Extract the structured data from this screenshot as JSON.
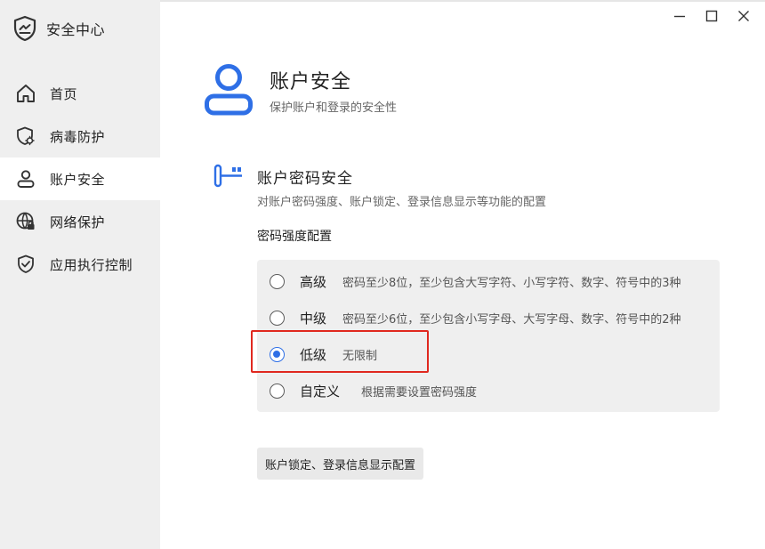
{
  "app": {
    "title": "安全中心",
    "icon": "shield-icon"
  },
  "sidebar": {
    "items": [
      {
        "label": "首页",
        "icon": "home-icon",
        "active": false
      },
      {
        "label": "病毒防护",
        "icon": "virus-shield-icon",
        "active": false
      },
      {
        "label": "账户安全",
        "icon": "user-icon",
        "active": true
      },
      {
        "label": "网络保护",
        "icon": "globe-lock-icon",
        "active": false
      },
      {
        "label": "应用执行控制",
        "icon": "app-shield-icon",
        "active": false
      }
    ]
  },
  "window_controls": {
    "minimize": "minimize-icon",
    "maximize": "maximize-icon",
    "close": "close-icon"
  },
  "header": {
    "title": "账户安全",
    "subtitle": "保护账户和登录的安全性"
  },
  "section": {
    "title": "账户密码安全",
    "description": "对账户密码强度、账户锁定、登录信息显示等功能的配置",
    "strength_label": "密码强度配置"
  },
  "options": [
    {
      "name": "高级",
      "desc": "密码至少8位，至少包含大写字符、小写字符、数字、符号中的3种",
      "checked": false
    },
    {
      "name": "中级",
      "desc": "密码至少6位，至少包含小写字母、大写字母、数字、符号中的2种",
      "checked": false
    },
    {
      "name": "低级",
      "desc": "无限制",
      "checked": true
    },
    {
      "name": "自定义",
      "desc": "根据需要设置密码强度",
      "checked": false
    }
  ],
  "lock_button": "账户锁定、登录信息显示配置",
  "colors": {
    "accent": "#2e6fe6",
    "highlight": "#e0281f",
    "sidebar_bg": "#efefef"
  }
}
